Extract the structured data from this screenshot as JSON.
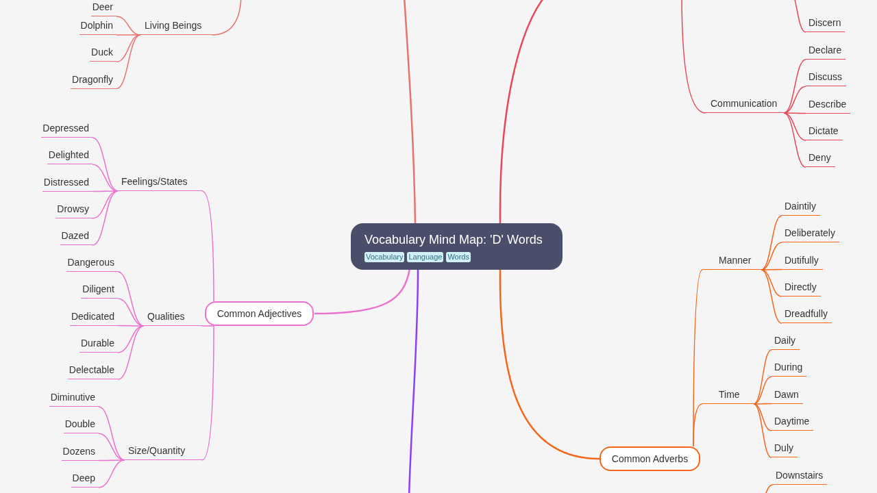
{
  "title": "Vocabulary Mind Map: 'D' Words",
  "tags": [
    "Vocabulary",
    "Language",
    "Words"
  ],
  "branches": [
    {
      "color": "#e5736f",
      "subtopics": [
        {
          "label": "Living Beings",
          "children": [
            "Deer",
            "Dolphin",
            "Duck",
            "Dragonfly"
          ]
        }
      ]
    },
    {
      "color": "#e8475a",
      "subtopics": [
        {
          "children": [
            "Discern"
          ]
        },
        {
          "label": "Communication",
          "children": [
            "Declare",
            "Discuss",
            "Describe",
            "Dictate",
            "Deny"
          ]
        }
      ]
    },
    {
      "label": "Common Adjectives",
      "color": "#ec6fcf",
      "subtopics": [
        {
          "label": "Feelings/States",
          "children": [
            "Depressed",
            "Delighted",
            "Distressed",
            "Drowsy",
            "Dazed"
          ]
        },
        {
          "label": "Qualities",
          "children": [
            "Dangerous",
            "Diligent",
            "Dedicated",
            "Durable",
            "Delectable"
          ]
        },
        {
          "label": "Size/Quantity",
          "children": [
            "Diminutive",
            "Double",
            "Dozens",
            "Deep"
          ]
        }
      ]
    },
    {
      "color": "#8a3ffc"
    },
    {
      "label": "Common Adverbs",
      "color": "#f5661c",
      "subtopics": [
        {
          "label": "Manner",
          "children": [
            "Daintily",
            "Deliberately",
            "Dutifully",
            "Directly",
            "Dreadfully"
          ]
        },
        {
          "label": "Time",
          "children": [
            "Daily",
            "During",
            "Dawn",
            "Daytime",
            "Duly"
          ]
        },
        {
          "children": [
            "Downstairs"
          ]
        }
      ]
    }
  ]
}
